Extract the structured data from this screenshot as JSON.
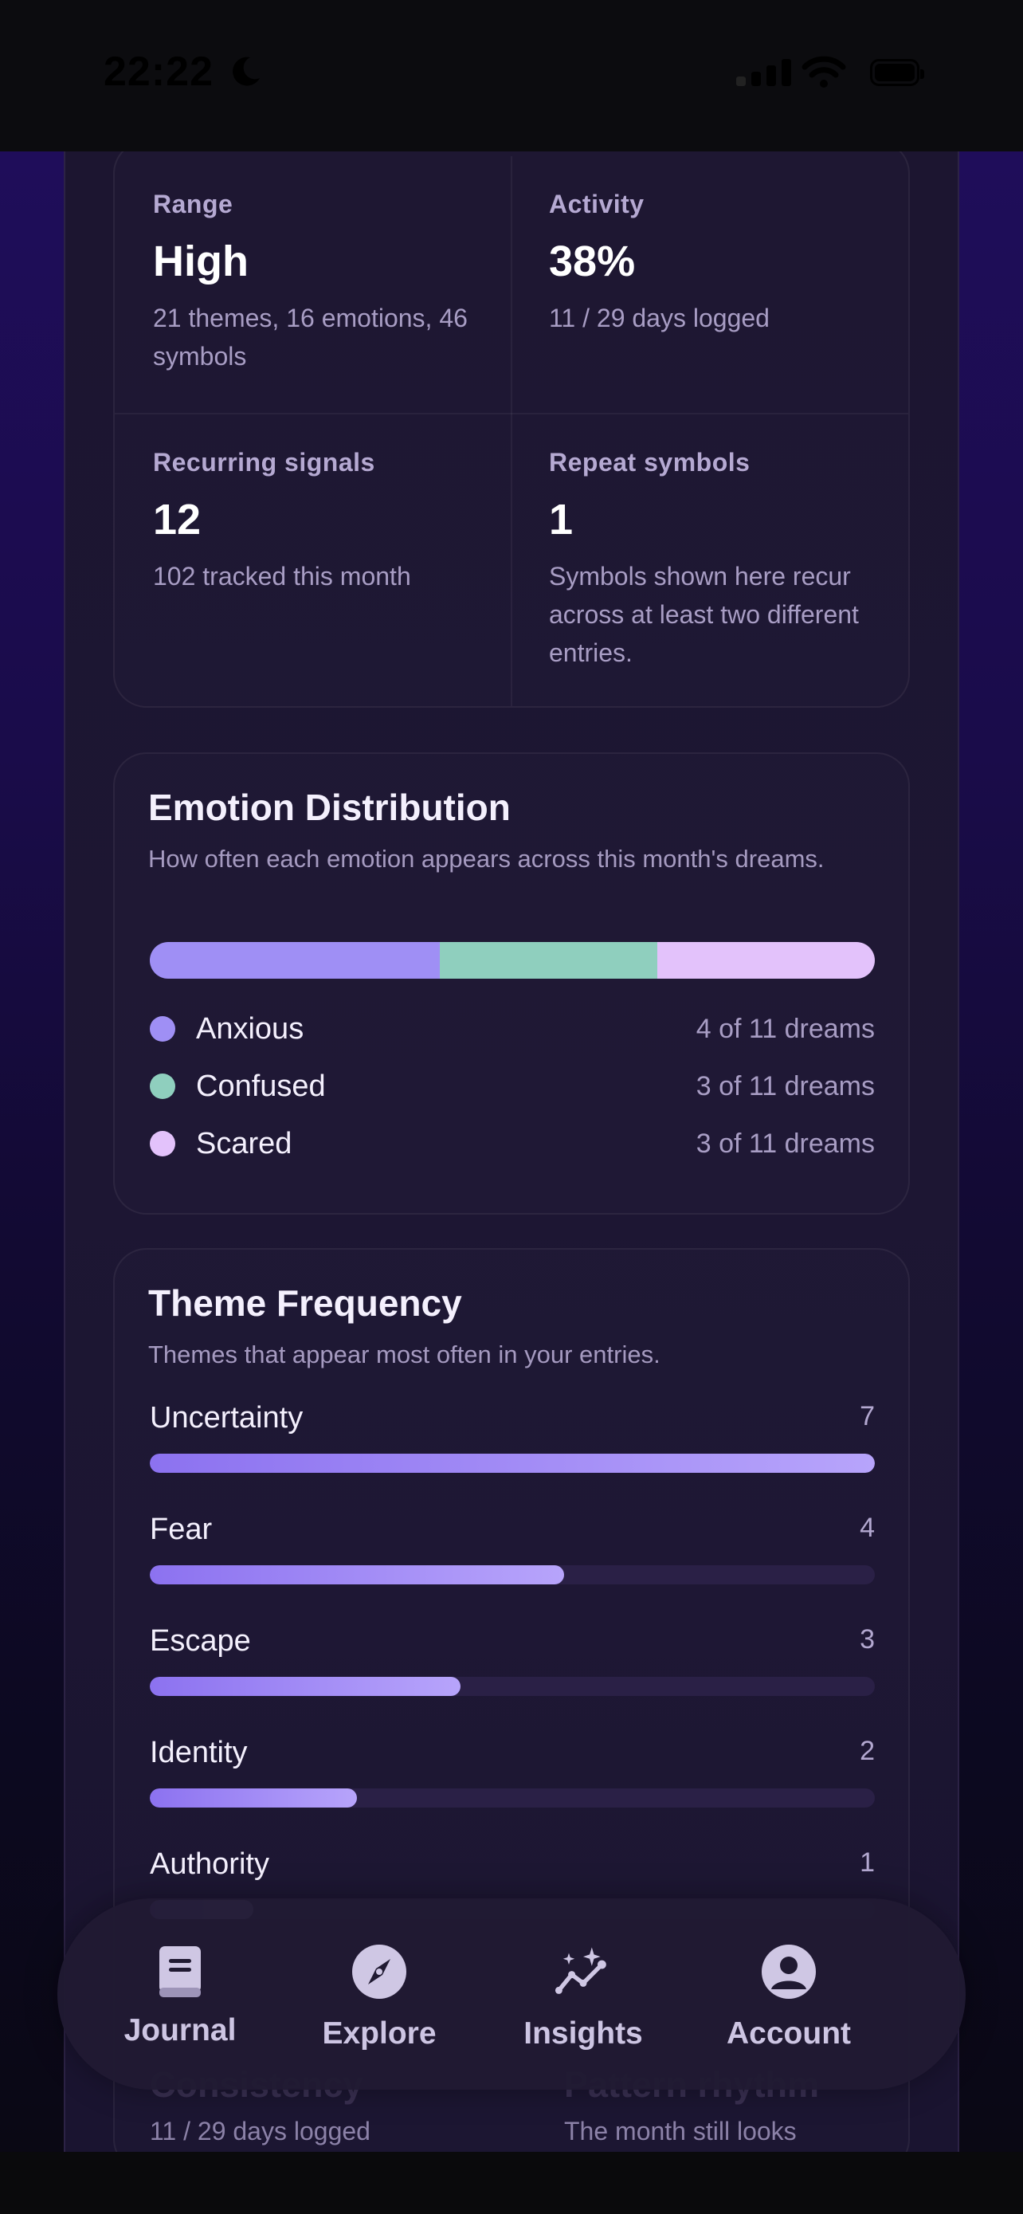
{
  "status_bar": {
    "time": "22:22"
  },
  "stats": {
    "range": {
      "label": "Range",
      "value": "High",
      "desc": "21 themes, 16 emotions, 46 symbols"
    },
    "activity": {
      "label": "Activity",
      "value": "38%",
      "desc": "11 / 29 days logged"
    },
    "recurring": {
      "label": "Recurring signals",
      "value": "12",
      "desc": "102 tracked this month"
    },
    "repeat": {
      "label": "Repeat symbols",
      "value": "1",
      "desc": "Symbols shown here recur across at least two different entries."
    }
  },
  "emotion_distribution": {
    "title": "Emotion Distribution",
    "subtitle": "How often each emotion appears across this month's dreams.",
    "items": [
      {
        "name": "Anxious",
        "count": "4 of 11 dreams",
        "value": 4,
        "color": "#9f8ff5"
      },
      {
        "name": "Confused",
        "count": "3 of 11 dreams",
        "value": 3,
        "color": "#8fcfbe"
      },
      {
        "name": "Scared",
        "count": "3 of 11 dreams",
        "value": 3,
        "color": "#e3c2fb"
      }
    ]
  },
  "theme_frequency": {
    "title": "Theme Frequency",
    "subtitle": "Themes that appear most often in your entries.",
    "items": [
      {
        "name": "Uncertainty",
        "count": "7",
        "value": 7
      },
      {
        "name": "Fear",
        "count": "4",
        "value": 4
      },
      {
        "name": "Escape",
        "count": "3",
        "value": 3
      },
      {
        "name": "Identity",
        "count": "2",
        "value": 2
      },
      {
        "name": "Authority",
        "count": "1",
        "value": 1
      }
    ],
    "max": 7
  },
  "below": {
    "consistency_title": "Consistency",
    "consistency_sub": "11 / 29 days logged",
    "rhythm_title": "Pattern rhythm",
    "rhythm_sub": "The month still looks"
  },
  "tabbar": {
    "journal": "Journal",
    "explore": "Explore",
    "insights": "Insights",
    "account": "Account"
  }
}
